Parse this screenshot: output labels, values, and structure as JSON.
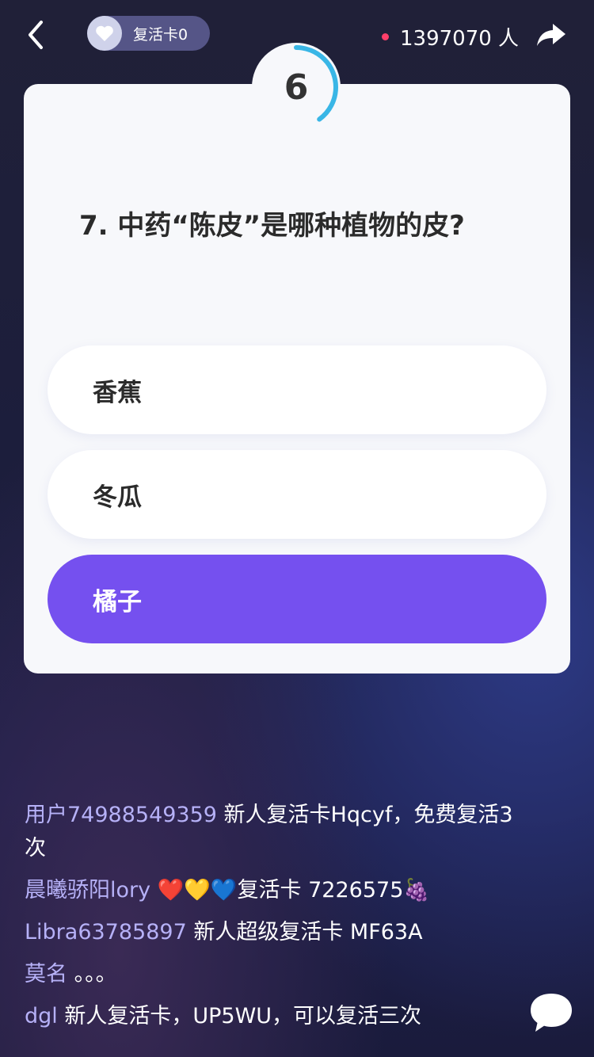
{
  "header": {
    "revive_card_label": "复活卡0",
    "online_count": "1397070 人",
    "icons": {
      "back": "chevron-left-icon",
      "heart": "heart-icon",
      "share": "share-arrow-icon"
    }
  },
  "timer": {
    "seconds": "6",
    "progress": 0.6
  },
  "question": {
    "text": "7. 中药“陈皮”是哪种植物的皮?",
    "options": [
      "香蕉",
      "冬瓜",
      "橘子"
    ],
    "selected_index": 2
  },
  "comments": [
    {
      "user": "用户74988549359",
      "text": " 新人复活卡Hqcyf，免费复活3次"
    },
    {
      "user": "晨曦骄阳lory",
      "text": " ❤️💛💙复活卡 7226575🍇"
    },
    {
      "user": "Libra63785897",
      "text": " 新人超级复活卡  MF63A"
    },
    {
      "user": "莫名",
      "text": " 。。。"
    },
    {
      "user": "dgl",
      "text": " 新人复活卡，UP5WU，可以复活三次"
    }
  ],
  "colors": {
    "accent": "#7550ef",
    "timer_ring": "#39b6e6",
    "live_dot": "#ff3f6a",
    "username": "#b6b1f7"
  }
}
